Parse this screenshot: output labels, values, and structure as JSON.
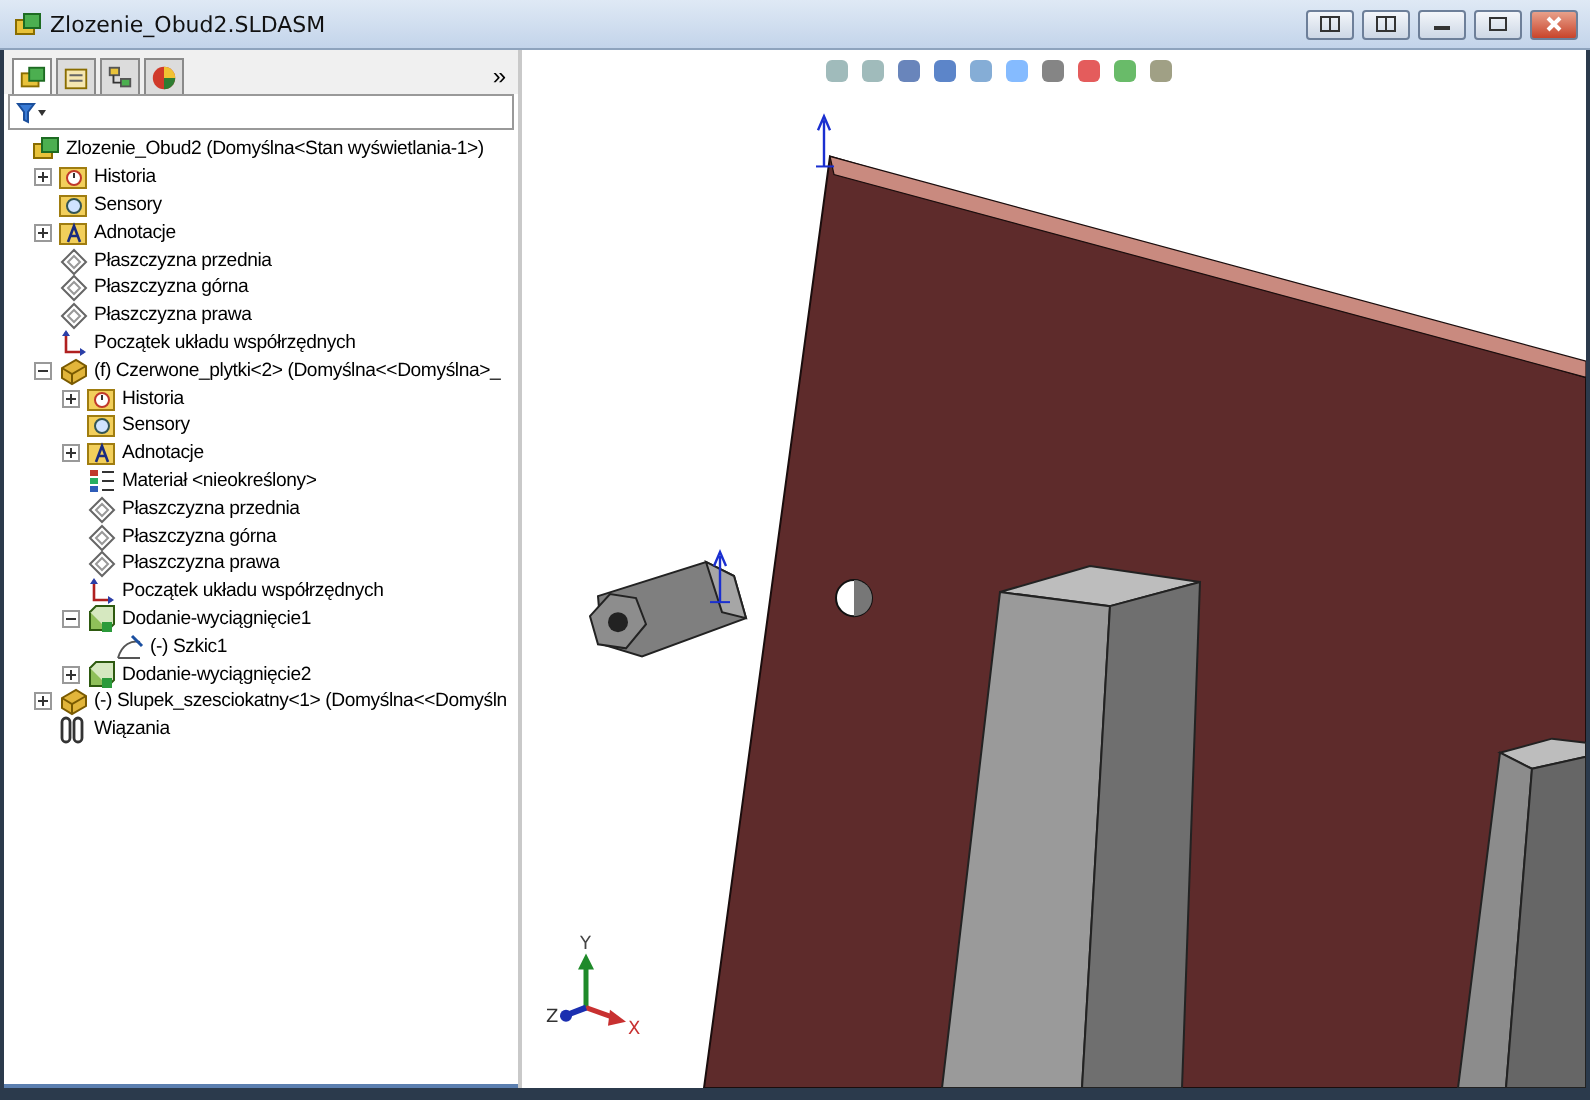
{
  "window": {
    "title": "Zlozenie_Obud2.SLDASM"
  },
  "panel_tabs": [
    {
      "kind": "feature",
      "selected": true
    },
    {
      "kind": "property",
      "selected": false
    },
    {
      "kind": "config",
      "selected": false
    },
    {
      "kind": "display",
      "selected": false
    }
  ],
  "panel_more": "»",
  "tree": [
    {
      "kind": "assembly",
      "label": "Zlozenie_Obud2  (Domyślna<Stan wyświetlania-1>)",
      "children": [
        {
          "kind": "history",
          "label": "Historia",
          "expanded": false
        },
        {
          "kind": "sensor",
          "label": "Sensory"
        },
        {
          "kind": "annotation",
          "label": "Adnotacje",
          "expanded": false
        },
        {
          "kind": "plane",
          "label": "Płaszczyzna przednia"
        },
        {
          "kind": "plane",
          "label": "Płaszczyzna górna"
        },
        {
          "kind": "plane",
          "label": "Płaszczyzna prawa"
        },
        {
          "kind": "origin",
          "label": "Początek układu współrzędnych"
        },
        {
          "kind": "part",
          "label": "(f) Czerwone_plytki<2> (Domyślna<<Domyślna>_",
          "expanded": true,
          "children": [
            {
              "kind": "history",
              "label": "Historia",
              "expanded": false
            },
            {
              "kind": "sensor",
              "label": "Sensory"
            },
            {
              "kind": "annotation",
              "label": "Adnotacje",
              "expanded": false
            },
            {
              "kind": "material",
              "label": "Materiał <nieokreślony>"
            },
            {
              "kind": "plane",
              "label": "Płaszczyzna przednia"
            },
            {
              "kind": "plane",
              "label": "Płaszczyzna górna"
            },
            {
              "kind": "plane",
              "label": "Płaszczyzna prawa"
            },
            {
              "kind": "origin",
              "label": "Początek układu współrzędnych"
            },
            {
              "kind": "feature",
              "label": "Dodanie-wyciągnięcie1",
              "expanded": true,
              "children": [
                {
                  "kind": "sketch",
                  "label": "(-) Szkic1"
                }
              ]
            },
            {
              "kind": "feature",
              "label": "Dodanie-wyciągnięcie2",
              "expanded": false
            }
          ]
        },
        {
          "kind": "part",
          "label": "(-) Slupek_szesciokatny<1> (Domyślna<<Domyśln",
          "expanded": false
        },
        {
          "kind": "mates",
          "label": "Wiązania"
        }
      ]
    }
  ],
  "triad": {
    "x": "X",
    "y": "Y",
    "z": "Z"
  }
}
